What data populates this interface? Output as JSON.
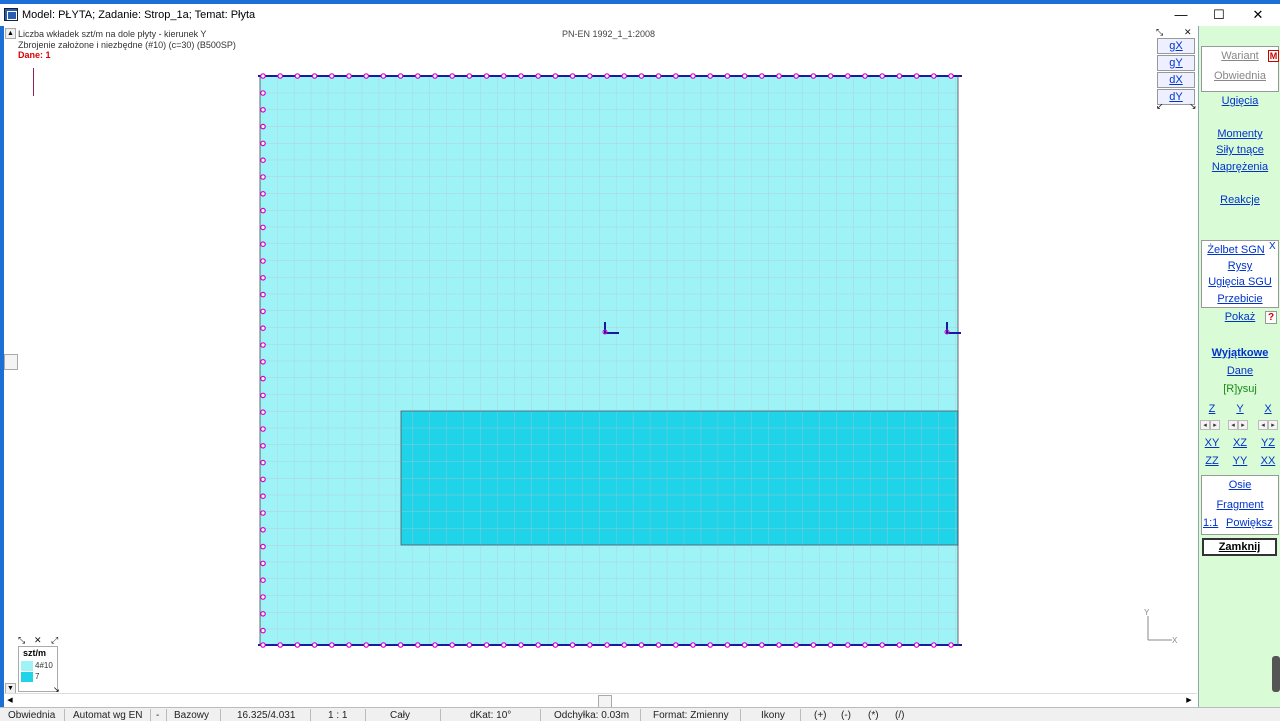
{
  "window": {
    "title": "Model: PŁYTA;  Zadanie: Strop_1a;  Temat: Płyta",
    "min_glyph": "—",
    "max_glyph": "☐",
    "close_glyph": "✕"
  },
  "info": {
    "line1": "Liczba wkładek szt/m na dole płyty - kierunek Y",
    "line2": "Zbrojenie założone i niezbędne (#10) (c=30) (B500SP)",
    "dane": "Dane: 1",
    "norm": "PN-EN 1992_1_1:2008"
  },
  "view_controls": [
    "gX",
    "gY",
    "dX",
    "dY"
  ],
  "right_panel": {
    "wariant": "Wariant",
    "wariant_badge": "M",
    "obwiednia": "Obwiednia",
    "ugiecia": "Ugięcia",
    "momenty": "Momenty",
    "sily": "Siły tnące",
    "naprezenia": "Naprężenia",
    "reakcje": "Reakcje",
    "zelbet": "Żelbet SGN",
    "zelbet_close": "X",
    "rysy": "Rysy",
    "ugiecia_sgu": "Ugięcia SGU",
    "przebicie": "Przebicie",
    "pokaz": "Pokaż",
    "help": "?",
    "wyjatkowe": "Wyjątkowe",
    "dane": "Dane",
    "rysuj": "[R]ysuj",
    "dirs_row1": [
      "Z",
      "Y",
      "X"
    ],
    "dirs_row2": [
      "XY",
      "XZ",
      "YZ"
    ],
    "dirs_row3": [
      "ZZ",
      "YY",
      "XX"
    ],
    "osie": "Osie",
    "fragment": "Fragment",
    "scale": "1:1",
    "powieksz": "Powiększ",
    "zamknij": "Zamknij"
  },
  "legend": {
    "title": "szt/m",
    "items": [
      {
        "label": "4#10",
        "color": "#9ef3f7"
      },
      {
        "label": "7",
        "color": "#1fd3e8"
      }
    ]
  },
  "axes": {
    "x": "X",
    "y": "Y"
  },
  "statusbar": [
    "Obwiednia",
    "Automat wg EN",
    "-",
    "Bazowy",
    "16.325/4.031",
    "1 : 1",
    "Cały",
    "dKat: 10°",
    "Odchyłka: 0.03m",
    "Format: Zmienny",
    "Ikony",
    "(+)",
    "(-)",
    "(*)",
    "(/)"
  ],
  "colors": {
    "plate_light": "#9ef3f7",
    "plate_dark": "#1fd3e8",
    "support_nodes": "#d400c8",
    "edge": "#1a1aa0",
    "panel_bg": "#d9fbd6",
    "link": "#0033cc"
  }
}
